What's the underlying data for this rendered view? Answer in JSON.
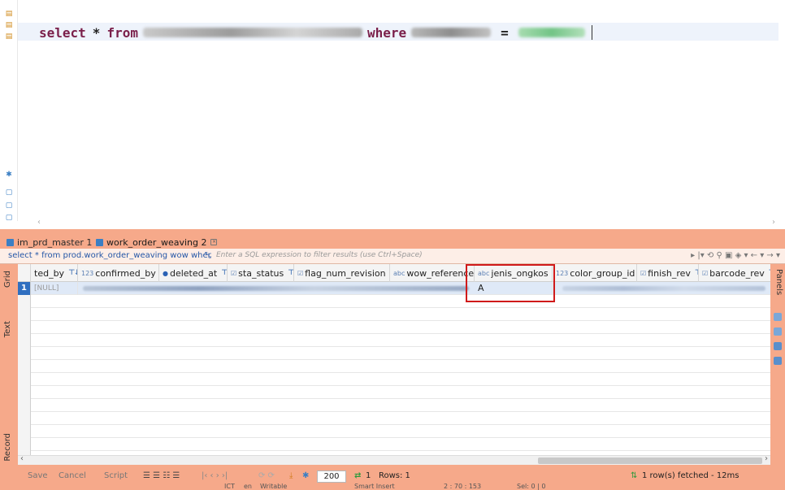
{
  "editor": {
    "kw_select": "select",
    "op_star": "*",
    "kw_from": "from",
    "kw_where": "where",
    "op_eq": "="
  },
  "tabs": [
    {
      "label": "im_prd_master 1"
    },
    {
      "label": "work_order_weaving 2"
    }
  ],
  "filter": {
    "query": "select * from prod.work_order_weaving wow wher",
    "placeholder": "Enter a SQL expression to filter results (use Ctrl+Space)"
  },
  "side_tabs": {
    "grid": "Grid",
    "text": "Text",
    "record": "Record",
    "panels": "Panels"
  },
  "columns": [
    {
      "label": "ted_by",
      "type": ""
    },
    {
      "label": "confirmed_by",
      "type": "123"
    },
    {
      "label": "deleted_at",
      "type": "●"
    },
    {
      "label": "sta_status",
      "type": "☑"
    },
    {
      "label": "flag_num_revision",
      "type": "☑"
    },
    {
      "label": "wow_reference",
      "type": "abc"
    },
    {
      "label": "jenis_ongkos",
      "type": "abc"
    },
    {
      "label": "color_group_id",
      "type": "123"
    },
    {
      "label": "finish_rev",
      "type": "☑"
    },
    {
      "label": "barcode_rev",
      "type": "☑"
    }
  ],
  "row": {
    "number": "1",
    "ted_by": "[NULL]",
    "jenis_ongkos": "A"
  },
  "toolbar": {
    "save": "Save",
    "cancel": "Cancel",
    "script": "Script",
    "fetch_size": "200",
    "count": "1",
    "rows": "Rows: 1",
    "fetched": "1 row(s) fetched - 12ms"
  },
  "statusbar": {
    "tz": "ICT",
    "locale": "en",
    "mode": "Writable",
    "insert": "Smart Insert",
    "pos": "2 : 70 : 153",
    "sel": "Sel: 0 | 0"
  },
  "colors": {
    "panel": "#f6a98a",
    "keyword": "#7a1f4a",
    "highlight": "#d01a1a"
  }
}
